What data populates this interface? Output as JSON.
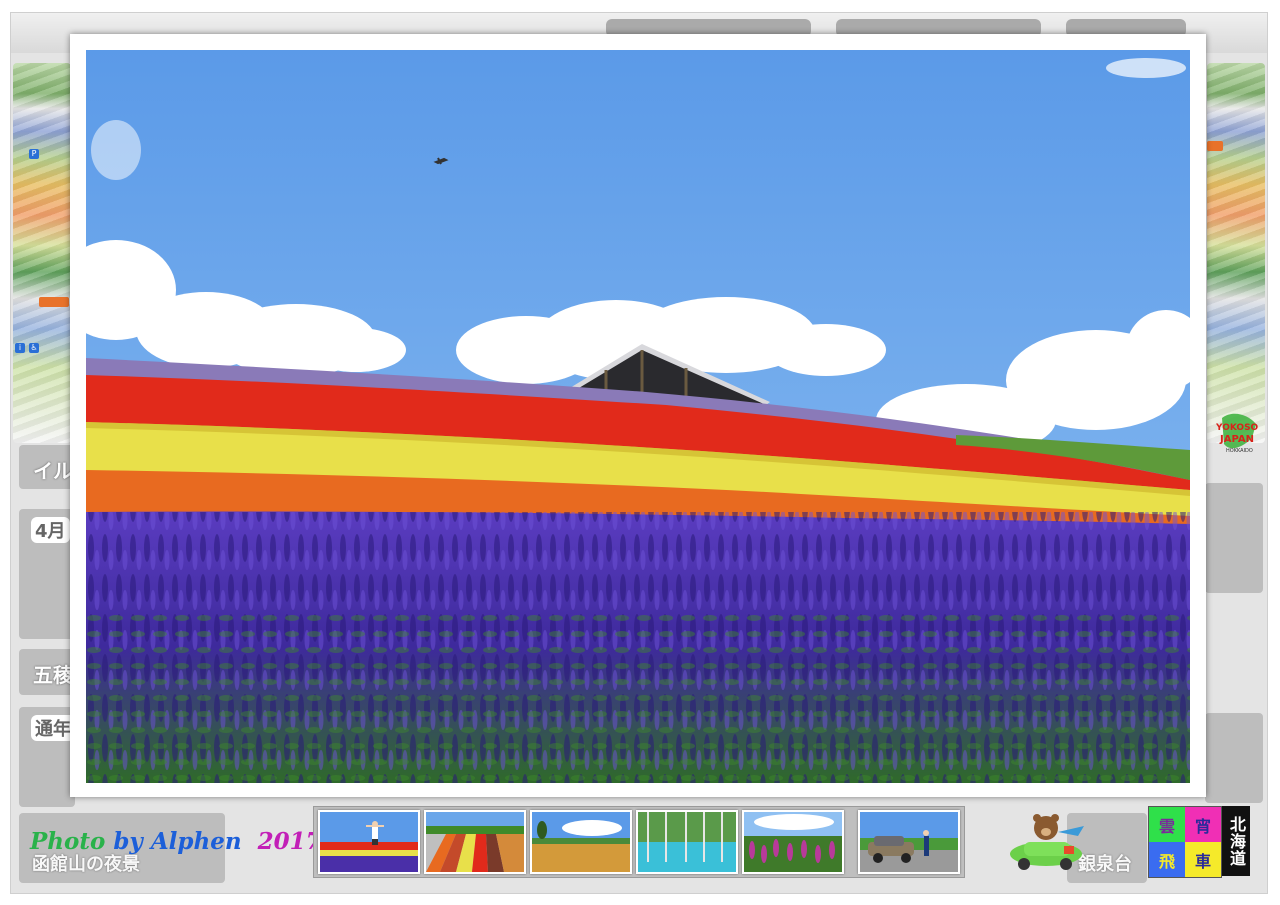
{
  "credit": {
    "photo": "Photo",
    "by": "by",
    "name": "Alphen",
    "year": "2017"
  },
  "background_captions": {
    "left_bottom": "函館山の夜景",
    "right_bottom": "銀泉台",
    "card_1": "イル",
    "card_2": "4月",
    "card_3": "五稜",
    "card_4": "通年"
  },
  "logos": {
    "grid_chars": [
      "雲",
      "宵",
      "飛",
      "車"
    ],
    "grid_colors": [
      "#2fe04a",
      "#f02fb5",
      "#3a6cf0",
      "#f5ea2a"
    ],
    "vertical": "北海道",
    "yokoso": "YOKOSO JAPAN",
    "yokoso_sub": "HOKKAIDO"
  },
  "thumbnails": [
    {
      "name": "thumb-person-flower-field"
    },
    {
      "name": "thumb-striped-fields"
    },
    {
      "name": "thumb-wheat-field-tree"
    },
    {
      "name": "thumb-blue-pond"
    },
    {
      "name": "thumb-lupine-field"
    },
    {
      "name": "thumb-car-countryside"
    }
  ],
  "colors": {
    "sky": "#6aa6ea",
    "red_band": "#e12a1b",
    "yellow_band": "#e8e04a",
    "orange_band": "#e86a20",
    "purple_band": "#4a2fa8"
  }
}
